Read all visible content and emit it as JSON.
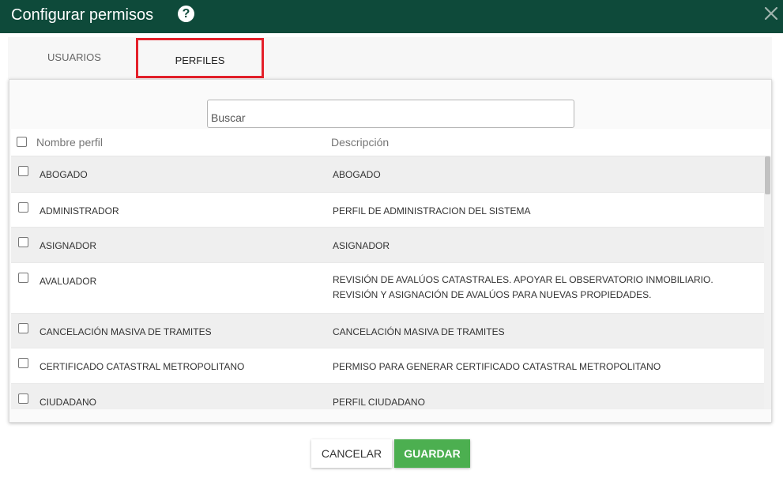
{
  "dialog": {
    "title": "Configurar permisos",
    "help_icon": "question-circle-icon",
    "close_icon": "close-icon",
    "header_color": "#0e4a3a"
  },
  "tabs": [
    {
      "label": "USUARIOS",
      "active": false
    },
    {
      "label": "PERFILES",
      "active": true
    }
  ],
  "search": {
    "placeholder": "Buscar",
    "value": ""
  },
  "table": {
    "columns": [
      "Nombre perfil",
      "Descripción"
    ],
    "rows": [
      {
        "name": "ABOGADO",
        "description": "ABOGADO",
        "checked": false
      },
      {
        "name": "ADMINISTRADOR",
        "description": "PERFIL DE ADMINISTRACION DEL SISTEMA",
        "checked": false
      },
      {
        "name": "ASIGNADOR",
        "description": "ASIGNADOR",
        "checked": false
      },
      {
        "name": "AVALUADOR",
        "description": "REVISIÓN DE AVALÚOS CATASTRALES. APOYAR EL OBSERVATORIO INMOBILIARIO. REVISIÓN Y ASIGNACIÓN DE AVALÚOS PARA NUEVAS PROPIEDADES.",
        "checked": false
      },
      {
        "name": "CANCELACIÓN MASIVA DE TRAMITES",
        "description": "CANCELACIÓN MASIVA DE TRAMITES",
        "checked": false
      },
      {
        "name": "CERTIFICADO CATASTRAL METROPOLITANO",
        "description": "PERMISO PARA GENERAR CERTIFICADO CATASTRAL METROPOLITANO",
        "checked": false
      },
      {
        "name": "CIUDADANO",
        "description": "PERFIL CIUDADANO",
        "checked": false
      }
    ]
  },
  "buttons": {
    "cancel": "CANCELAR",
    "save": "GUARDAR",
    "save_color": "#4caf50"
  }
}
